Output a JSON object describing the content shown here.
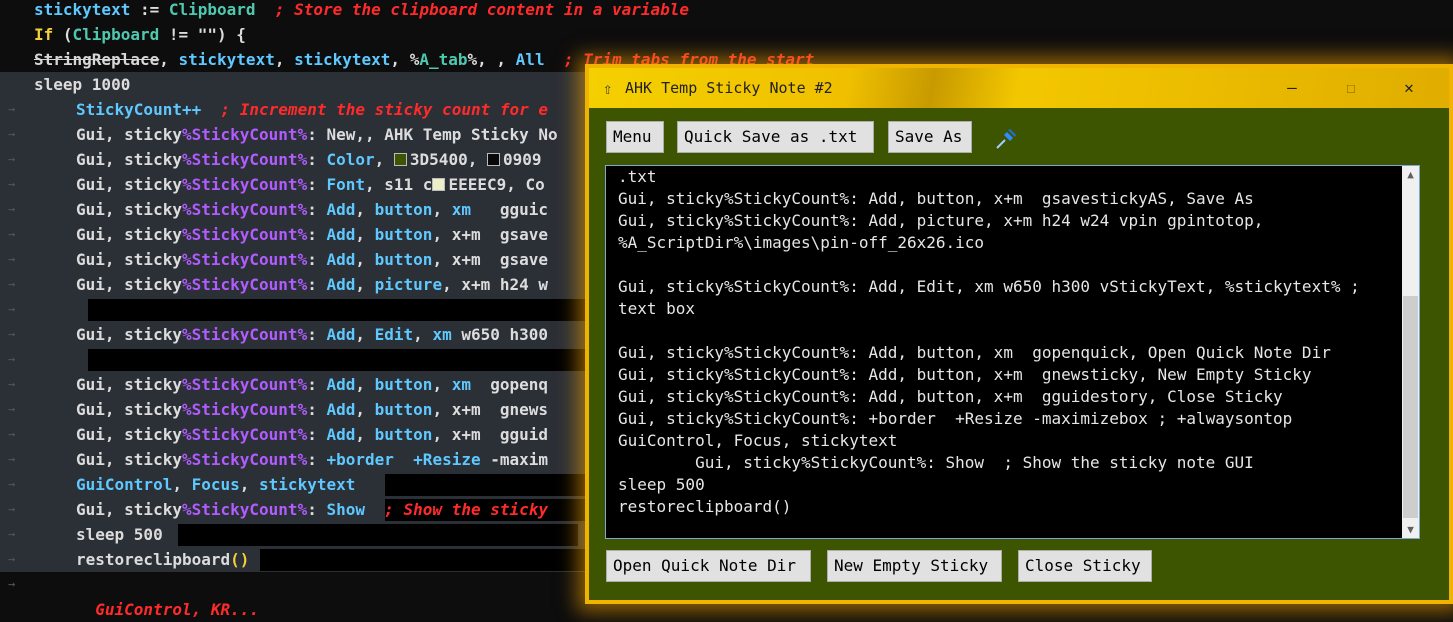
{
  "editor": {
    "lines": [
      {
        "parts": [
          [
            "var",
            "stickytext"
          ],
          [
            "dim",
            " := "
          ],
          [
            "grn",
            "Clipboard"
          ],
          [
            "dim",
            "  "
          ],
          [
            "cmt",
            "; Store the clipboard content in a variable"
          ]
        ]
      },
      {
        "parts": [
          [
            "yel",
            "If"
          ],
          [
            "dim",
            " ("
          ],
          [
            "grn",
            "Clipboard"
          ],
          [
            "dim",
            " != \"\") {"
          ]
        ]
      },
      {
        "parts": [
          [
            "strike",
            "StringReplace"
          ],
          [
            "dim",
            ", "
          ],
          [
            "var",
            "stickytext"
          ],
          [
            "dim",
            ", "
          ],
          [
            "var",
            "stickytext"
          ],
          [
            "dim",
            ", "
          ],
          [
            "dim",
            "%"
          ],
          [
            "grn",
            "A_tab"
          ],
          [
            "dim",
            "%, , "
          ],
          [
            "cmd",
            "All"
          ],
          [
            "dim",
            "  "
          ],
          [
            "cmt",
            "; Trim tabs from the start"
          ]
        ]
      },
      {
        "parts": [
          [
            "dim",
            "sleep 1000"
          ]
        ]
      },
      {
        "parts": [
          [
            "var",
            "StickyCount++"
          ],
          [
            "dim",
            "  "
          ],
          [
            "cmt",
            "; Increment the sticky count for e"
          ]
        ]
      },
      {
        "parts": [
          [
            "dim",
            "Gui, sticky"
          ],
          [
            "pur",
            "%StickyCount%"
          ],
          [
            "dim",
            ": New,, AHK Temp Sticky No"
          ]
        ]
      },
      {
        "parts": [
          [
            "dim",
            "Gui, sticky"
          ],
          [
            "pur",
            "%StickyCount%"
          ],
          [
            "dim",
            ": "
          ],
          [
            "cmd",
            "Color"
          ],
          [
            "dim",
            ", "
          ],
          [
            "sw",
            "#3d5400"
          ],
          [
            "dim",
            "3D5400, "
          ],
          [
            "sw",
            "#090909"
          ],
          [
            "dim",
            "0909"
          ]
        ]
      },
      {
        "parts": [
          [
            "dim",
            "Gui, sticky"
          ],
          [
            "pur",
            "%StickyCount%"
          ],
          [
            "dim",
            ": "
          ],
          [
            "cmd",
            "Font"
          ],
          [
            "dim",
            ", s11 c"
          ],
          [
            "sw",
            "#eeeec9"
          ],
          [
            "dim",
            "EEEEC9, Co"
          ]
        ]
      },
      {
        "parts": [
          [
            "dim",
            "Gui, sticky"
          ],
          [
            "pur",
            "%StickyCount%"
          ],
          [
            "dim",
            ": "
          ],
          [
            "cmd",
            "Add"
          ],
          [
            "dim",
            ", "
          ],
          [
            "cmd",
            "button"
          ],
          [
            "dim",
            ", "
          ],
          [
            "cmd",
            "xm"
          ],
          [
            "dim",
            "   gguic"
          ]
        ]
      },
      {
        "parts": [
          [
            "dim",
            "Gui, sticky"
          ],
          [
            "pur",
            "%StickyCount%"
          ],
          [
            "dim",
            ": "
          ],
          [
            "cmd",
            "Add"
          ],
          [
            "dim",
            ", "
          ],
          [
            "cmd",
            "button"
          ],
          [
            "dim",
            ", x+m  gsave"
          ]
        ]
      },
      {
        "parts": [
          [
            "dim",
            "Gui, sticky"
          ],
          [
            "pur",
            "%StickyCount%"
          ],
          [
            "dim",
            ": "
          ],
          [
            "cmd",
            "Add"
          ],
          [
            "dim",
            ", "
          ],
          [
            "cmd",
            "button"
          ],
          [
            "dim",
            ", x+m  gsave"
          ]
        ]
      },
      {
        "parts": [
          [
            "dim",
            "Gui, sticky"
          ],
          [
            "pur",
            "%StickyCount%"
          ],
          [
            "dim",
            ": "
          ],
          [
            "cmd",
            "Add"
          ],
          [
            "dim",
            ", "
          ],
          [
            "cmd",
            "picture"
          ],
          [
            "dim",
            ", x+m h24 w"
          ]
        ]
      },
      {
        "parts": []
      },
      {
        "parts": [
          [
            "dim",
            "Gui, sticky"
          ],
          [
            "pur",
            "%StickyCount%"
          ],
          [
            "dim",
            ": "
          ],
          [
            "cmd",
            "Add"
          ],
          [
            "dim",
            ", "
          ],
          [
            "cmd",
            "Edit"
          ],
          [
            "dim",
            ", "
          ],
          [
            "cmd",
            "xm"
          ],
          [
            "dim",
            " w650 h300"
          ]
        ]
      },
      {
        "parts": []
      },
      {
        "parts": [
          [
            "dim",
            "Gui, sticky"
          ],
          [
            "pur",
            "%StickyCount%"
          ],
          [
            "dim",
            ": "
          ],
          [
            "cmd",
            "Add"
          ],
          [
            "dim",
            ", "
          ],
          [
            "cmd",
            "button"
          ],
          [
            "dim",
            ", "
          ],
          [
            "cmd",
            "xm"
          ],
          [
            "dim",
            "  gopenq"
          ]
        ]
      },
      {
        "parts": [
          [
            "dim",
            "Gui, sticky"
          ],
          [
            "pur",
            "%StickyCount%"
          ],
          [
            "dim",
            ": "
          ],
          [
            "cmd",
            "Add"
          ],
          [
            "dim",
            ", "
          ],
          [
            "cmd",
            "button"
          ],
          [
            "dim",
            ", x+m  gnews"
          ]
        ]
      },
      {
        "parts": [
          [
            "dim",
            "Gui, sticky"
          ],
          [
            "pur",
            "%StickyCount%"
          ],
          [
            "dim",
            ": "
          ],
          [
            "cmd",
            "Add"
          ],
          [
            "dim",
            ", "
          ],
          [
            "cmd",
            "button"
          ],
          [
            "dim",
            ", x+m  gguid"
          ]
        ]
      },
      {
        "parts": [
          [
            "dim",
            "Gui, sticky"
          ],
          [
            "pur",
            "%StickyCount%"
          ],
          [
            "dim",
            ": "
          ],
          [
            "cmd",
            "+border"
          ],
          [
            "dim",
            "  "
          ],
          [
            "cmd",
            "+Resize"
          ],
          [
            "dim",
            " -maxim"
          ]
        ]
      },
      {
        "parts": [
          [
            "var",
            "GuiControl"
          ],
          [
            "dim",
            ", "
          ],
          [
            "cmd",
            "Focus"
          ],
          [
            "dim",
            ", "
          ],
          [
            "var",
            "stickytext"
          ]
        ]
      },
      {
        "parts": [
          [
            "dim",
            "Gui, sticky"
          ],
          [
            "pur",
            "%StickyCount%"
          ],
          [
            "dim",
            ": "
          ],
          [
            "cmd",
            "Show"
          ],
          [
            "dim",
            "  "
          ],
          [
            "cmt",
            "; Show the sticky"
          ]
        ]
      },
      {
        "parts": [
          [
            "dim",
            "sleep 500"
          ]
        ]
      },
      {
        "parts": [
          [
            "dim",
            "restoreclipboard"
          ],
          [
            "yel",
            "()"
          ]
        ]
      },
      {
        "parts": []
      },
      {
        "parts": [
          [
            "cmt",
            "  GuiControl, KR..."
          ]
        ]
      }
    ]
  },
  "window": {
    "title": "AHK Temp Sticky Note #2",
    "icon": "arrow-up-icon",
    "menu_label": "Menu",
    "quick_save_label": "Quick Save as .txt",
    "save_as_label": "Save As",
    "pin_icon": "pin-icon",
    "open_dir_label": "Open Quick Note Dir",
    "new_sticky_label": "New Empty Sticky",
    "close_sticky_label": "Close Sticky",
    "minimize": "—",
    "maximize": "☐",
    "close": "✕",
    "text_lines": [
      ".txt",
      "Gui, sticky%StickyCount%: Add, button, x+m  gsavestickyAS, Save As",
      "Gui, sticky%StickyCount%: Add, picture, x+m h24 w24 vpin gpintotop,",
      "%A_ScriptDir%\\images\\pin-off_26x26.ico",
      "",
      "Gui, sticky%StickyCount%: Add, Edit, xm w650 h300 vStickyText, %stickytext% ;",
      "text box",
      "",
      "Gui, sticky%StickyCount%: Add, button, xm  gopenquick, Open Quick Note Dir",
      "Gui, sticky%StickyCount%: Add, button, x+m  gnewsticky, New Empty Sticky",
      "Gui, sticky%StickyCount%: Add, button, x+m  gguidestory, Close Sticky",
      "Gui, sticky%StickyCount%: +border  +Resize -maximizebox ; +alwaysontop",
      "GuiControl, Focus, stickytext",
      "        Gui, sticky%StickyCount%: Show  ; Show the sticky note GUI",
      "sleep 500",
      "restoreclipboard()"
    ]
  },
  "colors": {
    "window_bg": "#3d5400",
    "border": "#f0b400",
    "editor_bg": "#0d0d0d"
  }
}
